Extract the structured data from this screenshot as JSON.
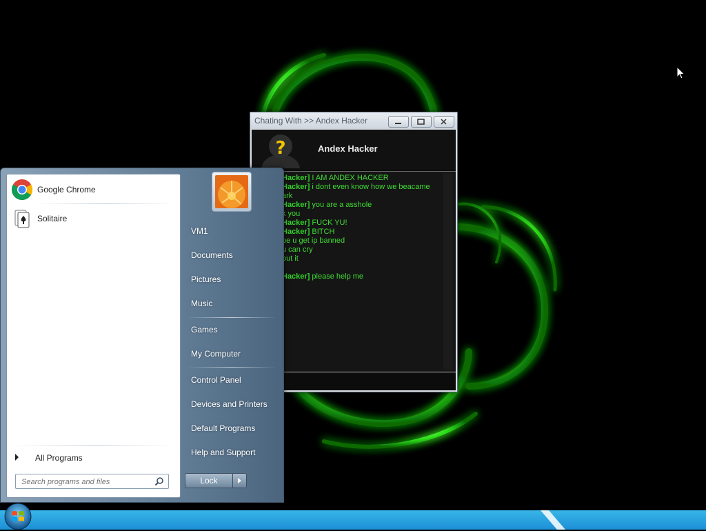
{
  "chat_window": {
    "title": "Chating With >> Andex Hacker",
    "contact_name": "Andex Hacker",
    "avatar_icon": "unknown-user-question-icon",
    "messages": [
      {
        "who": "Hacker]",
        "text": " I AM ANDEX HACKER"
      },
      {
        "who": "Hacker]",
        "text": " i dont even know how we beacame"
      },
      {
        "who": "",
        "text": "ark"
      },
      {
        "who": "Hacker]",
        "text": " you are a asshole"
      },
      {
        "who": "",
        "text": "k you"
      },
      {
        "who": "Hacker]",
        "text": " FUCK YU!"
      },
      {
        "who": "Hacker]",
        "text": " BITCH"
      },
      {
        "who": "",
        "text": "pe u get ip banned"
      },
      {
        "who": "",
        "text": "u can cry"
      },
      {
        "who": "",
        "text": "out it"
      },
      {
        "who": "Hacker]",
        "text": " please help me"
      }
    ],
    "text_color": "#3fdc32"
  },
  "start_menu": {
    "pinned": [
      {
        "label": "Google Chrome",
        "icon": "chrome-icon"
      },
      {
        "label": "Solitaire",
        "icon": "solitaire-icon"
      }
    ],
    "all_programs_label": "All Programs",
    "search_placeholder": "Search programs and files",
    "right_items": [
      {
        "label": "VM1"
      },
      {
        "label": "Documents"
      },
      {
        "label": "Pictures"
      },
      {
        "label": "Music"
      },
      {
        "label": "Games"
      },
      {
        "label": "My Computer"
      },
      {
        "label": "Control Panel"
      },
      {
        "label": "Devices and Printers"
      },
      {
        "label": "Default Programs"
      },
      {
        "label": "Help and Support"
      }
    ],
    "lock_label": "Lock"
  },
  "taskbar": {
    "start_icon": "windows-start-orb-icon",
    "color": "#1d8fd6"
  }
}
